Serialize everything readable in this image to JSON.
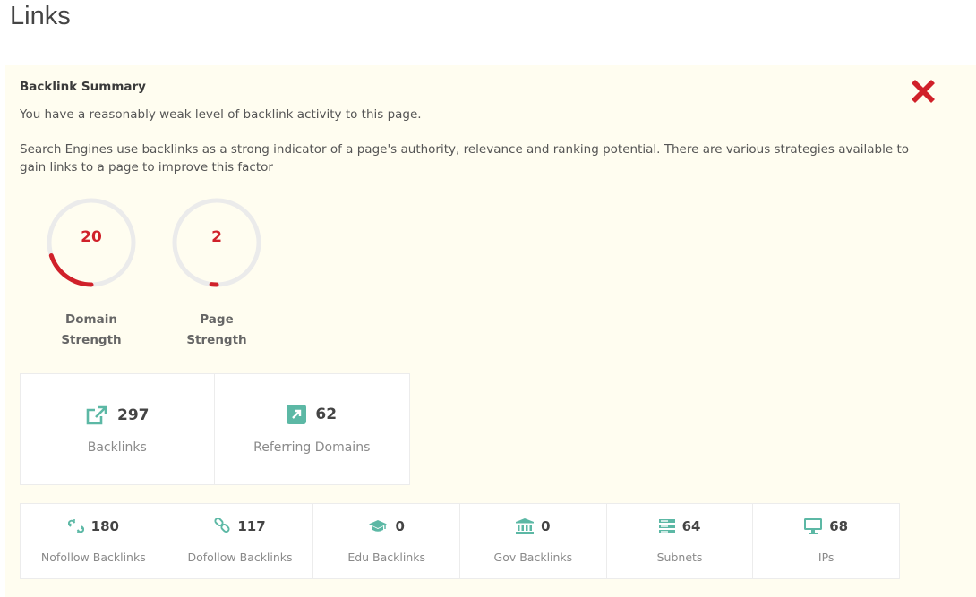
{
  "page": {
    "title": "Links"
  },
  "summary": {
    "title": "Backlink Summary",
    "text": "You have a reasonably weak level of backlink activity to this page.",
    "description": "Search Engines use backlinks as a strong indicator of a page's authority, relevance and ranking potential. There are various strategies available to gain links to a page to improve this factor",
    "status_icon": "close-icon",
    "status_color": "#d0212a"
  },
  "gauges": [
    {
      "value": "20",
      "fraction": 0.2,
      "label_line1": "Domain",
      "label_line2": "Strength",
      "color": "#d0212a"
    },
    {
      "value": "2",
      "fraction": 0.02,
      "label_line1": "Page",
      "label_line2": "Strength",
      "color": "#d0212a"
    }
  ],
  "primary_stats": [
    {
      "icon": "external-link-icon",
      "value": "297",
      "label": "Backlinks"
    },
    {
      "icon": "arrow-up-right-square-icon",
      "value": "62",
      "label": "Referring Domains"
    }
  ],
  "secondary_stats": [
    {
      "icon": "broken-link-icon",
      "value": "180",
      "label": "Nofollow Backlinks"
    },
    {
      "icon": "link-icon",
      "value": "117",
      "label": "Dofollow Backlinks"
    },
    {
      "icon": "graduation-cap-icon",
      "value": "0",
      "label": "Edu Backlinks"
    },
    {
      "icon": "bank-icon",
      "value": "0",
      "label": "Gov Backlinks"
    },
    {
      "icon": "server-icon",
      "value": "64",
      "label": "Subnets"
    },
    {
      "icon": "monitor-icon",
      "value": "68",
      "label": "IPs"
    }
  ],
  "colors": {
    "icon_teal": "#5cb8a5",
    "panel_bg": "#fffdf0"
  }
}
